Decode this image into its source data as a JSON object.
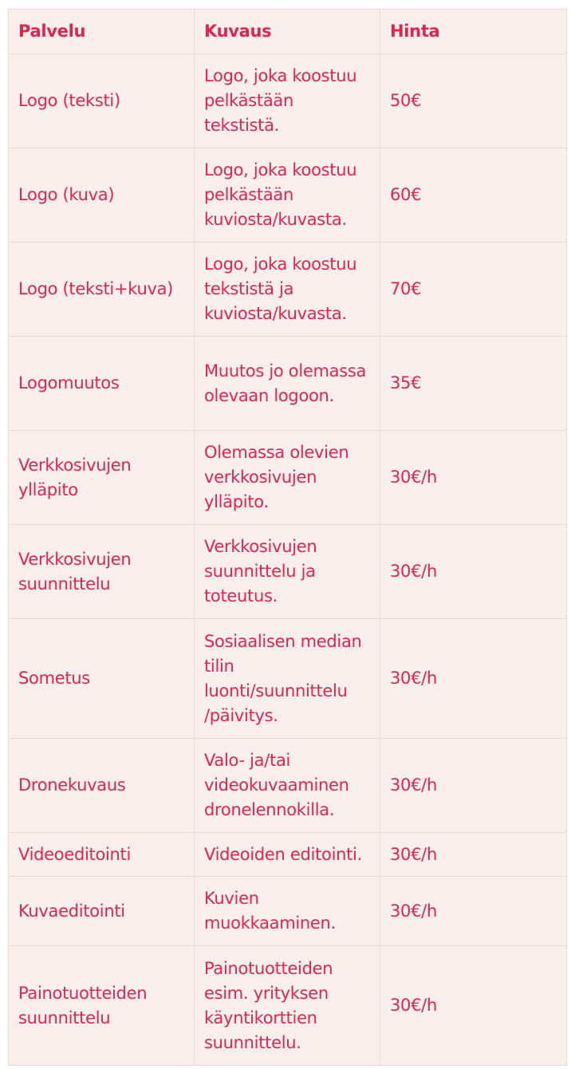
{
  "table": {
    "headers": [
      "Palvelu",
      "Kuvaus",
      "Hinta"
    ],
    "rows": [
      {
        "service": "Logo (teksti)",
        "description": "Logo, joka koostuu pelkästään tekstistä.",
        "price": "50€"
      },
      {
        "service": "Logo (kuva)",
        "description": "Logo, joka koostuu pelkästään kuviosta/kuvasta.",
        "price": "60€"
      },
      {
        "service": "Logo (teksti+kuva)",
        "description": "Logo, joka koostuu tekstistä ja kuviosta/kuvasta.",
        "price": "70€"
      },
      {
        "service": "Logomuutos",
        "description": "Muutos jo olemassa olevaan logoon.",
        "price": "35€"
      },
      {
        "service": "Verkkosivujen ylläpito",
        "description": "Olemassa olevien verkkosivujen ylläpito.",
        "price": "30€/h"
      },
      {
        "service": "Verkkosivujen suunnittelu",
        "description": "Verkkosivujen suunnittelu ja toteutus.",
        "price": "30€/h"
      },
      {
        "service": "Sometus",
        "description": "Sosiaalisen median tilin luonti/suunnittelu /päivitys.",
        "price": "30€/h"
      },
      {
        "service": "Dronekuvaus",
        "description": "Valo- ja/tai videokuvaaminen dronelennokilla.",
        "price": "30€/h"
      },
      {
        "service": "Videoeditointi",
        "description": "Videoiden editointi.",
        "price": "30€/h"
      },
      {
        "service": "Kuvaeditointi",
        "description": "Kuvien muokkaaminen.",
        "price": "30€/h"
      },
      {
        "service": "Painotuotteiden suunnittelu",
        "description": "Painotuotteiden esim. yrityksen käyntikorttien suunnittelu.",
        "price": "30€/h"
      }
    ]
  },
  "colors": {
    "text": "#e1254f",
    "cell_background": "#fbefee",
    "border": "#e7d9d8"
  }
}
